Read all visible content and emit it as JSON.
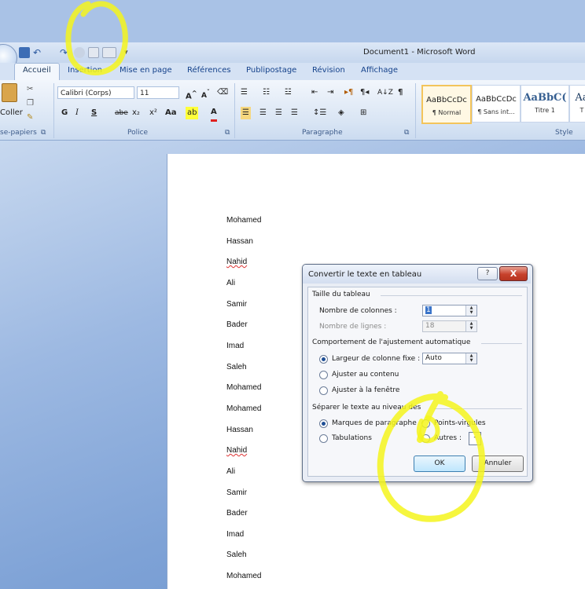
{
  "window": {
    "title": "Document1 - Microsoft Word"
  },
  "ribbon_tabs": [
    {
      "label": "Accueil",
      "active": true
    },
    {
      "label": "Insertion"
    },
    {
      "label": "Mise en page"
    },
    {
      "label": "Références"
    },
    {
      "label": "Publipostage"
    },
    {
      "label": "Révision"
    },
    {
      "label": "Affichage"
    }
  ],
  "clipboard": {
    "paste_label": "Coller",
    "group_label": "se-papiers"
  },
  "font": {
    "family": "Calibri (Corps)",
    "size": "11",
    "group_label": "Police",
    "bold": "G",
    "italic": "I",
    "underline": "S",
    "strike": "abe",
    "subscript": "x₂",
    "superscript": "x²",
    "case": "Aa"
  },
  "paragraph": {
    "group_label": "Paragraphe"
  },
  "styles": {
    "group_label": "Style",
    "items": [
      {
        "preview": "AaBbCcDc",
        "name": "¶ Normal",
        "selected": true
      },
      {
        "preview": "AaBbCcDc",
        "name": "¶ Sans int..."
      },
      {
        "preview": "AaBbC(",
        "name": "Titre 1"
      },
      {
        "preview": "Aa",
        "name": "T"
      }
    ]
  },
  "document": {
    "lines": [
      "Mohamed",
      "Hassan",
      "Nahid",
      "Ali",
      "Samir",
      "Bader",
      "Imad",
      "Saleh",
      "Mohamed",
      "Mohamed",
      "Hassan",
      "Nahid",
      "Ali",
      "Samir",
      "Bader",
      "Imad",
      "Saleh",
      "Mohamed"
    ]
  },
  "dialog": {
    "title": "Convertir le texte en tableau",
    "help": "?",
    "close": "X",
    "size_section": "Taille du tableau",
    "columns_label": "Nombre de colonnes :",
    "columns_value": "1",
    "rows_label": "Nombre de lignes :",
    "rows_value": "18",
    "autofit_section": "Comportement de l'ajustement automatique",
    "fixed_width_label": "Largeur de colonne fixe :",
    "fixed_width_value": "Auto",
    "fit_contents_label": "Ajuster au contenu",
    "fit_window_label": "Ajuster à la fenêtre",
    "separator_section": "Séparer le texte au niveau des",
    "paragraph_marks_label": "Marques de paragraphe",
    "semicolons_label": "Points-virgules",
    "tabs_label": "Tabulations",
    "other_label": "Autres :",
    "other_value": "-",
    "ok_label": "OK",
    "cancel_label": "Annuler"
  },
  "colors": {
    "highlight": "#f5f51c",
    "accent": "#15428b"
  }
}
